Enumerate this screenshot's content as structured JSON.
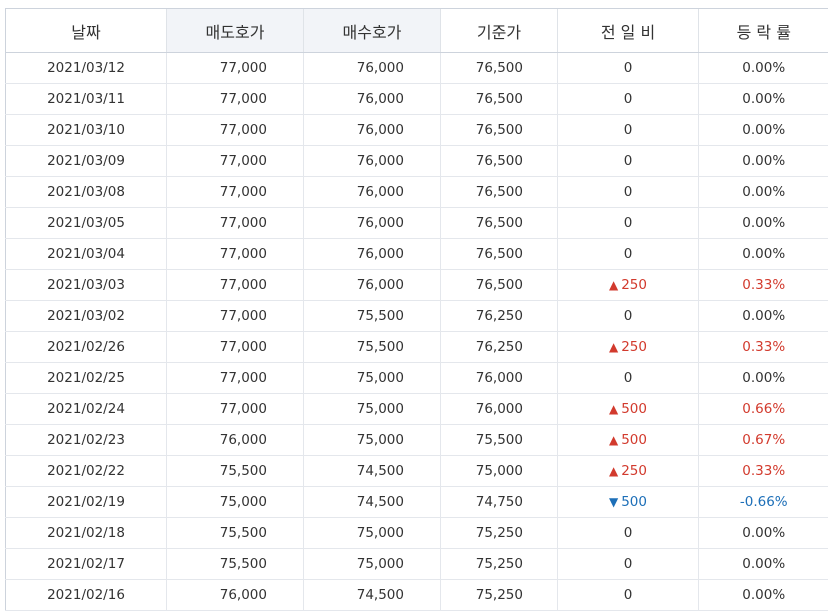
{
  "headers": [
    "날짜",
    "매도호가",
    "매수호가",
    "기준가",
    "전 일 비",
    "등 락 률"
  ],
  "colors": {
    "up": "#d23a2d",
    "down": "#1d6fb8",
    "header_bg": "#f2f4f8"
  },
  "rows": [
    {
      "date": "2021/03/12",
      "ask": "77,000",
      "bid": "76,000",
      "base": "76,500",
      "dir": "none",
      "change": "0",
      "rate": "0.00%"
    },
    {
      "date": "2021/03/11",
      "ask": "77,000",
      "bid": "76,000",
      "base": "76,500",
      "dir": "none",
      "change": "0",
      "rate": "0.00%"
    },
    {
      "date": "2021/03/10",
      "ask": "77,000",
      "bid": "76,000",
      "base": "76,500",
      "dir": "none",
      "change": "0",
      "rate": "0.00%"
    },
    {
      "date": "2021/03/09",
      "ask": "77,000",
      "bid": "76,000",
      "base": "76,500",
      "dir": "none",
      "change": "0",
      "rate": "0.00%"
    },
    {
      "date": "2021/03/08",
      "ask": "77,000",
      "bid": "76,000",
      "base": "76,500",
      "dir": "none",
      "change": "0",
      "rate": "0.00%"
    },
    {
      "date": "2021/03/05",
      "ask": "77,000",
      "bid": "76,000",
      "base": "76,500",
      "dir": "none",
      "change": "0",
      "rate": "0.00%"
    },
    {
      "date": "2021/03/04",
      "ask": "77,000",
      "bid": "76,000",
      "base": "76,500",
      "dir": "none",
      "change": "0",
      "rate": "0.00%"
    },
    {
      "date": "2021/03/03",
      "ask": "77,000",
      "bid": "76,000",
      "base": "76,500",
      "dir": "up",
      "change": "250",
      "rate": "0.33%"
    },
    {
      "date": "2021/03/02",
      "ask": "77,000",
      "bid": "75,500",
      "base": "76,250",
      "dir": "none",
      "change": "0",
      "rate": "0.00%"
    },
    {
      "date": "2021/02/26",
      "ask": "77,000",
      "bid": "75,500",
      "base": "76,250",
      "dir": "up",
      "change": "250",
      "rate": "0.33%"
    },
    {
      "date": "2021/02/25",
      "ask": "77,000",
      "bid": "75,000",
      "base": "76,000",
      "dir": "none",
      "change": "0",
      "rate": "0.00%"
    },
    {
      "date": "2021/02/24",
      "ask": "77,000",
      "bid": "75,000",
      "base": "76,000",
      "dir": "up",
      "change": "500",
      "rate": "0.66%"
    },
    {
      "date": "2021/02/23",
      "ask": "76,000",
      "bid": "75,000",
      "base": "75,500",
      "dir": "up",
      "change": "500",
      "rate": "0.67%"
    },
    {
      "date": "2021/02/22",
      "ask": "75,500",
      "bid": "74,500",
      "base": "75,000",
      "dir": "up",
      "change": "250",
      "rate": "0.33%"
    },
    {
      "date": "2021/02/19",
      "ask": "75,000",
      "bid": "74,500",
      "base": "74,750",
      "dir": "down",
      "change": "500",
      "rate": "-0.66%"
    },
    {
      "date": "2021/02/18",
      "ask": "75,500",
      "bid": "75,000",
      "base": "75,250",
      "dir": "none",
      "change": "0",
      "rate": "0.00%"
    },
    {
      "date": "2021/02/17",
      "ask": "75,500",
      "bid": "75,000",
      "base": "75,250",
      "dir": "none",
      "change": "0",
      "rate": "0.00%"
    },
    {
      "date": "2021/02/16",
      "ask": "76,000",
      "bid": "74,500",
      "base": "75,250",
      "dir": "none",
      "change": "0",
      "rate": "0.00%"
    }
  ]
}
